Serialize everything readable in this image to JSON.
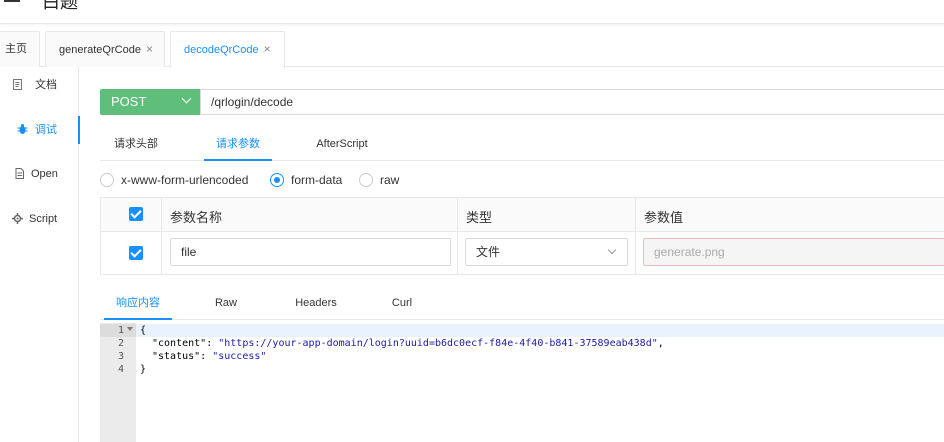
{
  "header": {
    "title": "白题"
  },
  "tabs": [
    {
      "label": "主页",
      "closable": false
    },
    {
      "label": "generateQrCode",
      "closable": true
    },
    {
      "label": "decodeQrCode",
      "closable": true,
      "active": true
    }
  ],
  "tab_close_glyph": "×",
  "sidebar": {
    "items": [
      {
        "label": "文档",
        "icon": "document-icon"
      },
      {
        "label": "调试",
        "icon": "bug-icon",
        "active": true
      },
      {
        "label": "Open",
        "icon": "file-icon"
      },
      {
        "label": "Script",
        "icon": "code-icon"
      }
    ]
  },
  "request": {
    "method": "POST",
    "url": "/qrlogin/decode",
    "method_color": "#5fbf7a"
  },
  "request_tabs": [
    "请求头部",
    "请求参数",
    "AfterScript"
  ],
  "body_types": [
    {
      "label": "x-www-form-urlencoded",
      "checked": false
    },
    {
      "label": "form-data",
      "checked": true
    },
    {
      "label": "raw",
      "checked": false
    }
  ],
  "params_table": {
    "headers": {
      "name": "参数名称",
      "type": "类型",
      "value": "参数值"
    },
    "rows": [
      {
        "checked": true,
        "name": "file",
        "type": "文件",
        "value_placeholder": "generate.png"
      }
    ]
  },
  "response_tabs": [
    "响应内容",
    "Raw",
    "Headers",
    "Curl"
  ],
  "response": {
    "line_numbers": [
      "1",
      "2",
      "3",
      "4"
    ],
    "lines": {
      "l1": "{",
      "l2_key": "\"content\"",
      "l2_colon": ": ",
      "l2_val": "\"https://your-app-domain/login?uuid=b6dc0ecf-f84e-4f40-b841-37589eab438d\"",
      "l2_comma": ",",
      "l3_key": "\"status\"",
      "l3_colon": ": ",
      "l3_val": "\"success\"",
      "l4": "}"
    }
  },
  "colors": {
    "accent": "#1890ff",
    "string": "#1a1aa6"
  }
}
